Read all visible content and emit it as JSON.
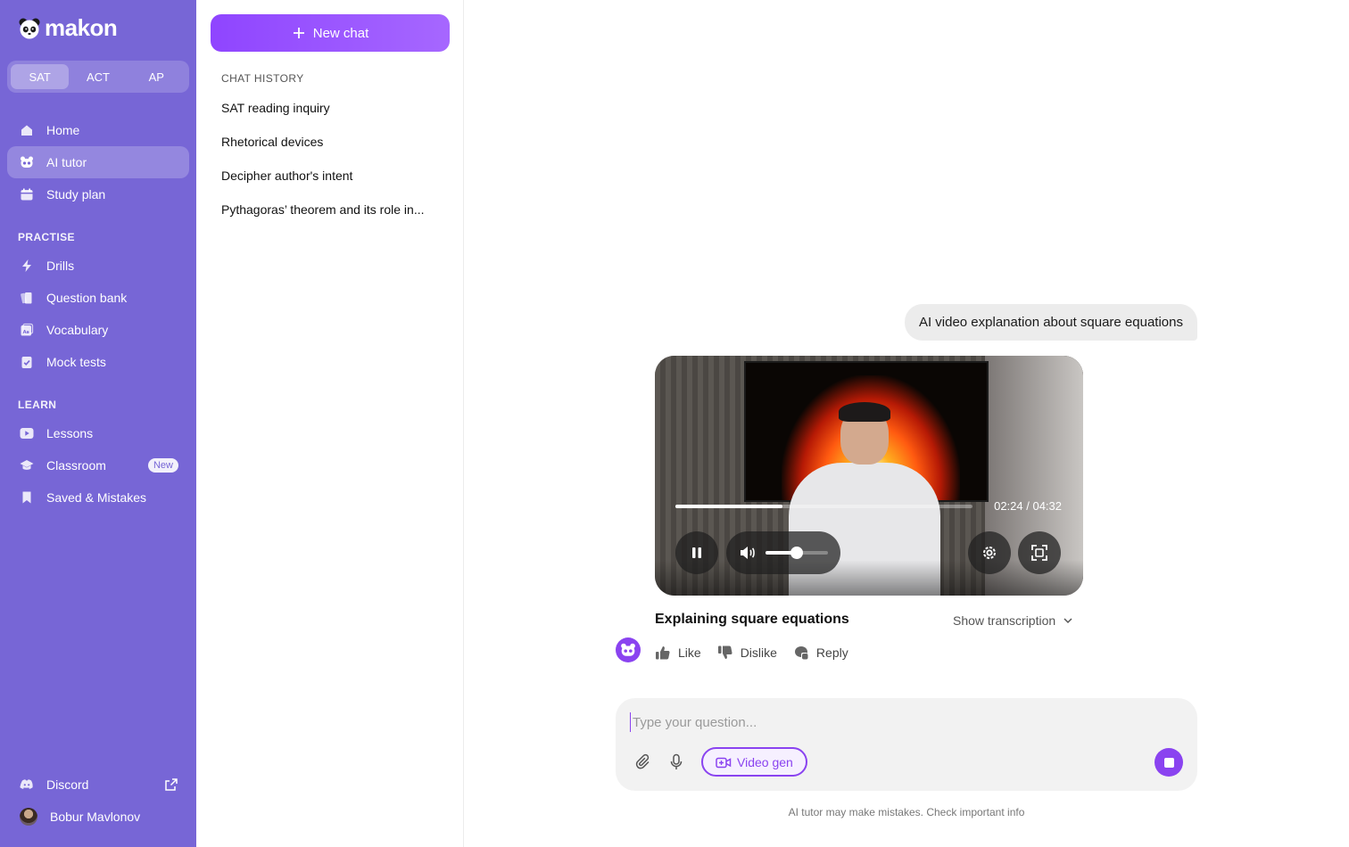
{
  "app": {
    "logo_text": "makon"
  },
  "exam_tabs": [
    {
      "label": "SAT",
      "active": true
    },
    {
      "label": "ACT",
      "active": false
    },
    {
      "label": "AP",
      "active": false
    }
  ],
  "nav": {
    "main": [
      {
        "label": "Home",
        "icon": "home-icon"
      },
      {
        "label": "AI tutor",
        "icon": "panda-icon",
        "active": true
      },
      {
        "label": "Study plan",
        "icon": "calendar-icon"
      }
    ],
    "practise_label": "PRACTISE",
    "practise": [
      {
        "label": "Drills",
        "icon": "bolt-icon"
      },
      {
        "label": "Question bank",
        "icon": "cards-icon"
      },
      {
        "label": "Vocabulary",
        "icon": "vocabulary-icon"
      },
      {
        "label": "Mock tests",
        "icon": "clipboard-check-icon"
      }
    ],
    "learn_label": "LEARN",
    "learn": [
      {
        "label": "Lessons",
        "icon": "play-icon"
      },
      {
        "label": "Classroom",
        "icon": "graduation-cap-icon",
        "badge": "New"
      },
      {
        "label": "Saved & Mistakes",
        "icon": "bookmark-icon"
      }
    ],
    "bottom": [
      {
        "label": "Discord",
        "icon": "discord-icon"
      },
      {
        "label": "Bobur Mavlonov",
        "icon": "avatar"
      }
    ]
  },
  "history": {
    "new_chat_label": "New chat",
    "section_label": "CHAT HISTORY",
    "items": [
      "SAT reading inquiry",
      "Rhetorical devices",
      "Decipher author's intent",
      "Pythagoras’ theorem and its role in..."
    ]
  },
  "chat": {
    "user_message": "AI video explanation about square equations",
    "video": {
      "time": "02:24 / 04:32",
      "progress": 0.36,
      "volume": 0.5,
      "title": "Explaining square equations"
    },
    "show_transcription": "Show transcription",
    "actions": {
      "like": "Like",
      "dislike": "Dislike",
      "reply": "Reply"
    }
  },
  "composer": {
    "placeholder": "Type your question...",
    "video_gen_label": "Video gen",
    "disclaimer": "AI tutor may make mistakes. Check important info"
  },
  "colors": {
    "sidebar": "#7766d6",
    "accent": "#8a43f0"
  }
}
